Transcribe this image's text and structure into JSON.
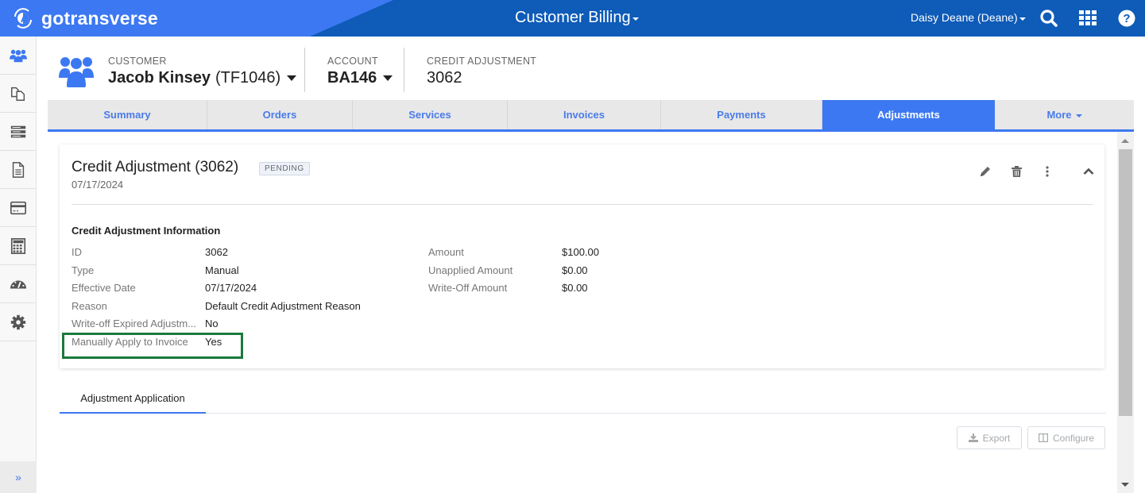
{
  "topbar": {
    "brand": "gotransverse",
    "app_title": "Customer Billing",
    "user": "Daisy Deane (Deane)",
    "icons": [
      "search-icon",
      "apps-grid-icon",
      "help-icon"
    ]
  },
  "sidebar": {
    "items": [
      {
        "name": "customers",
        "icon": "users-icon",
        "active": true
      },
      {
        "name": "documents",
        "icon": "copy-icon"
      },
      {
        "name": "services",
        "icon": "server-icon"
      },
      {
        "name": "invoices",
        "icon": "file-icon"
      },
      {
        "name": "payments",
        "icon": "credit-card-icon"
      },
      {
        "name": "calculator",
        "icon": "calculator-icon"
      },
      {
        "name": "dashboard",
        "icon": "gauge-icon"
      },
      {
        "name": "settings",
        "icon": "gear-icon"
      }
    ],
    "expand_label": "»"
  },
  "context": {
    "customer_label": "CUSTOMER",
    "customer_name": "Jacob Kinsey",
    "customer_id": "(TF1046)",
    "account_label": "ACCOUNT",
    "account_value": "BA146",
    "adjustment_label": "CREDIT ADJUSTMENT",
    "adjustment_value": "3062"
  },
  "tabs": [
    {
      "label": "Summary"
    },
    {
      "label": "Orders"
    },
    {
      "label": "Services"
    },
    {
      "label": "Invoices"
    },
    {
      "label": "Payments"
    },
    {
      "label": "Adjustments",
      "active": true
    },
    {
      "label": "More"
    }
  ],
  "card": {
    "title": "Credit Adjustment (3062)",
    "status": "PENDING",
    "date": "07/17/2024",
    "section_title": "Credit Adjustment Information",
    "left_fields": [
      {
        "label": "ID",
        "value": "3062"
      },
      {
        "label": "Type",
        "value": "Manual"
      },
      {
        "label": "Effective Date",
        "value": "07/17/2024"
      },
      {
        "label": "Reason",
        "value": "Default Credit Adjustment Reason"
      },
      {
        "label": "Write-off Expired Adjustm...",
        "value": "No"
      },
      {
        "label": "Manually Apply to Invoice",
        "value": "Yes"
      }
    ],
    "right_fields": [
      {
        "label": "Amount",
        "value": "$100.00"
      },
      {
        "label": "Unapplied Amount",
        "value": "$0.00"
      },
      {
        "label": "Write-Off Amount",
        "value": "$0.00"
      }
    ],
    "highlight_color": "#1a7a3c"
  },
  "subtabs": [
    {
      "label": "Adjustment Application",
      "active": true
    }
  ],
  "toolbar": {
    "export_label": "Export",
    "configure_label": "Configure"
  },
  "colors": {
    "accent": "#3c78f2",
    "topbar": "#0e5bb8"
  }
}
